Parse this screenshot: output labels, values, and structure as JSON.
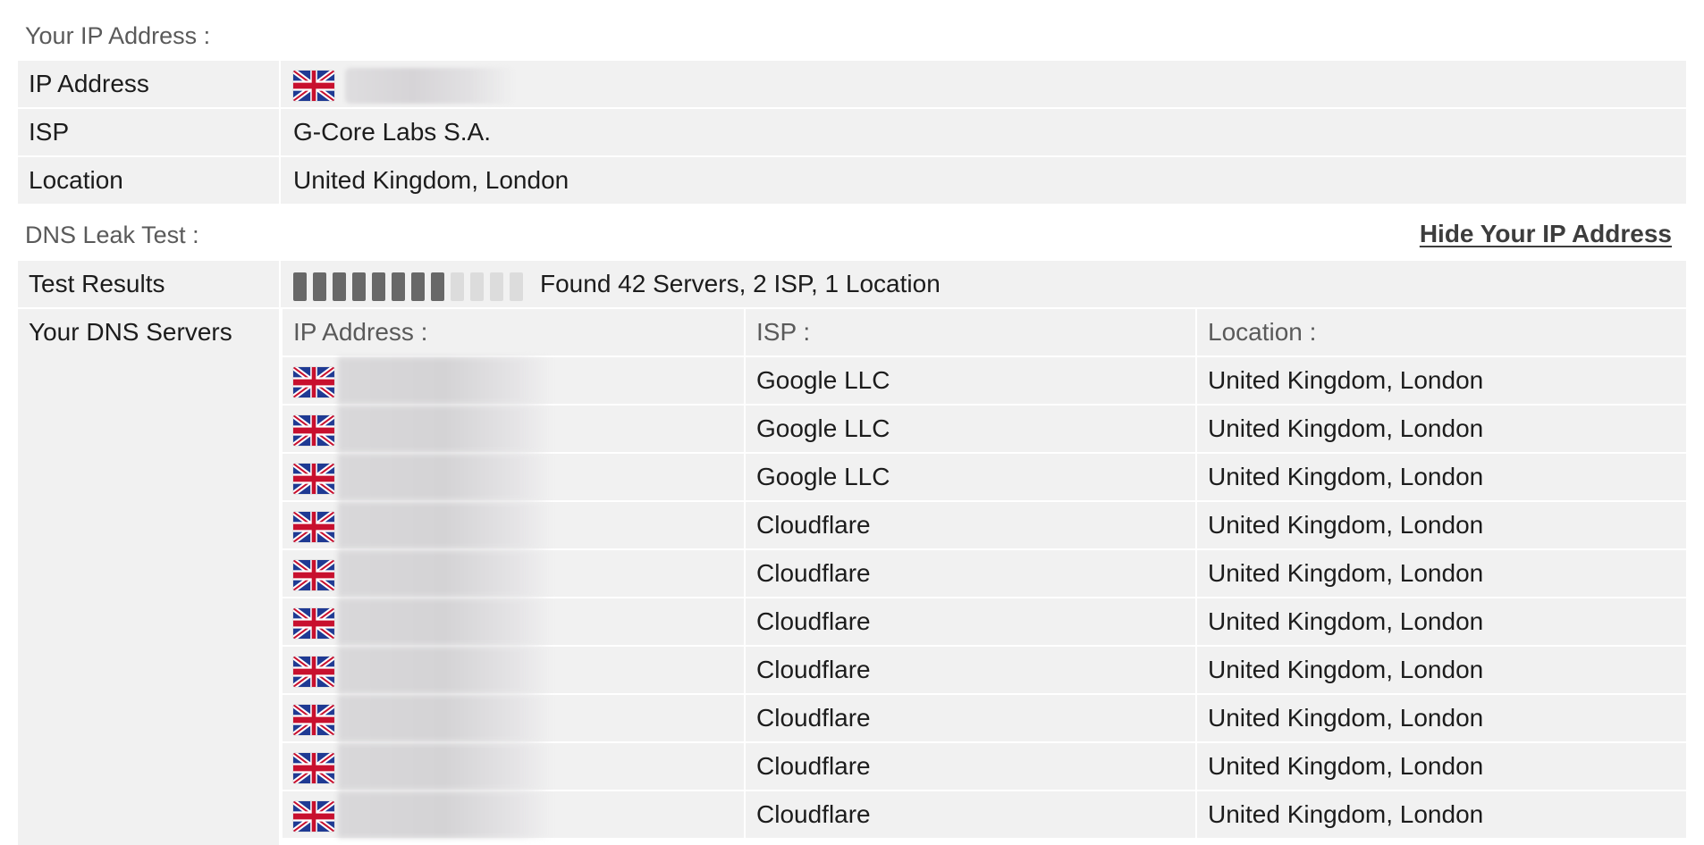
{
  "ip_section": {
    "title": "Your IP Address :",
    "rows": {
      "ip_label": "IP Address",
      "isp_label": "ISP",
      "isp_value": "G-Core Labs S.A.",
      "location_label": "Location",
      "location_value": "United Kingdom, London"
    }
  },
  "dns_section": {
    "title": "DNS Leak Test :",
    "hide_link": "Hide Your IP Address",
    "test_results_label": "Test Results",
    "test_results_text": "Found 42 Servers, 2 ISP, 1 Location",
    "progress": {
      "filled_segments": 8,
      "total_segments": 12
    },
    "servers_label": "Your DNS Servers",
    "columns": [
      "IP Address :",
      "ISP :",
      "Location :"
    ],
    "servers": [
      {
        "isp": "Google LLC",
        "location": "United Kingdom, London"
      },
      {
        "isp": "Google LLC",
        "location": "United Kingdom, London"
      },
      {
        "isp": "Google LLC",
        "location": "United Kingdom, London"
      },
      {
        "isp": "Cloudflare",
        "location": "United Kingdom, London"
      },
      {
        "isp": "Cloudflare",
        "location": "United Kingdom, London"
      },
      {
        "isp": "Cloudflare",
        "location": "United Kingdom, London"
      },
      {
        "isp": "Cloudflare",
        "location": "United Kingdom, London"
      },
      {
        "isp": "Cloudflare",
        "location": "United Kingdom, London"
      },
      {
        "isp": "Cloudflare",
        "location": "United Kingdom, London"
      },
      {
        "isp": "Cloudflare",
        "location": "United Kingdom, London"
      }
    ]
  },
  "icons": {
    "flag": "uk-flag-icon"
  },
  "colors": {
    "row_bg": "#f1f1f1",
    "progress_on": "#686868",
    "progress_off": "#dcdcdc"
  }
}
